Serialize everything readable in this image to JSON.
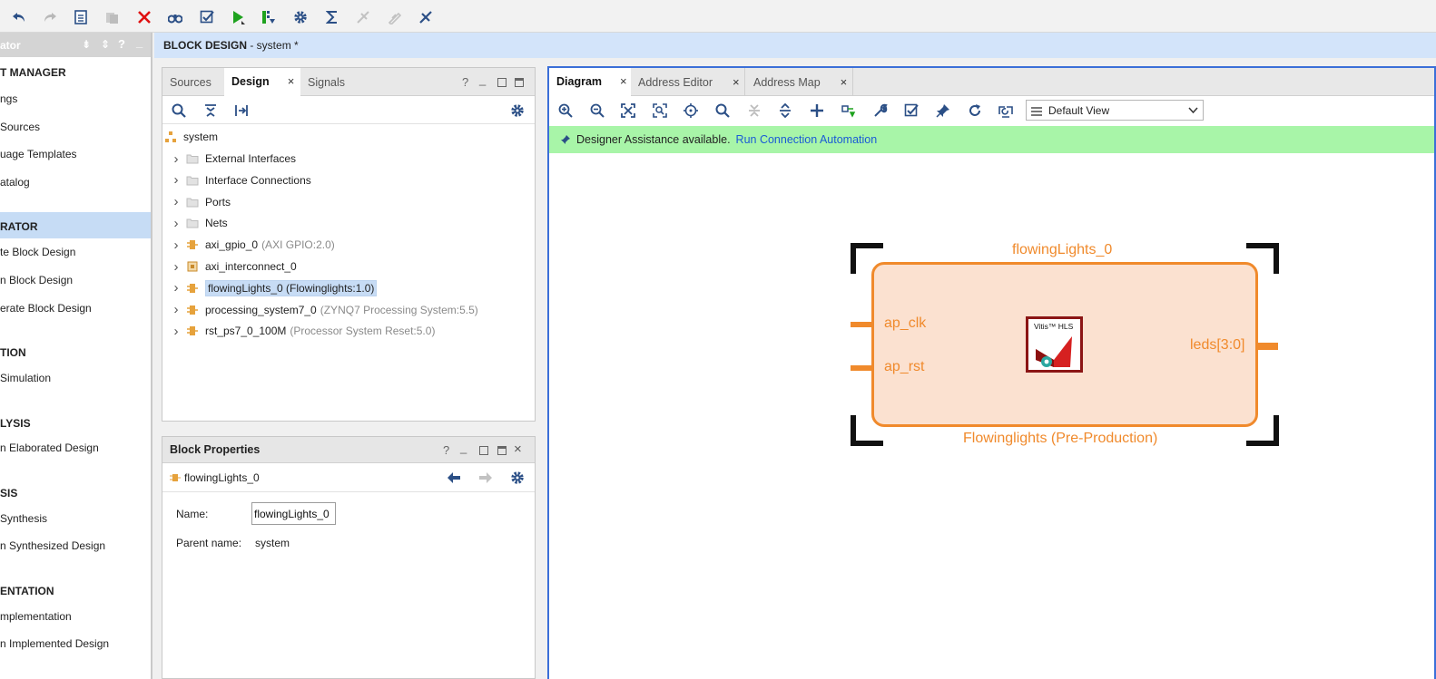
{
  "toolbar": {
    "icons": [
      "undo-icon",
      "redo-icon",
      "report-icon",
      "copy-icon",
      "delete-icon",
      "binoculars-icon",
      "validate-icon",
      "run-icon",
      "program-icon",
      "settings-icon",
      "sigma-icon",
      "debug-disabled-icon",
      "edit-disabled-icon",
      "tools-icon"
    ]
  },
  "flow_navigator": {
    "title": "ator",
    "sections": [
      {
        "label": "T MANAGER",
        "items": [
          "ngs",
          "Sources",
          "uage Templates",
          "atalog"
        ]
      },
      {
        "label": "RATOR",
        "items": [
          "te Block Design",
          "n Block Design",
          "erate Block Design"
        ]
      },
      {
        "label": "TION",
        "items": [
          "Simulation"
        ]
      },
      {
        "label": "LYSIS",
        "items": [
          "n Elaborated Design"
        ]
      },
      {
        "label": "SIS",
        "items": [
          "Synthesis",
          "n Synthesized Design"
        ]
      },
      {
        "label": "ENTATION",
        "items": [
          "mplementation",
          "n Implemented Design"
        ]
      }
    ]
  },
  "header": {
    "title": "BLOCK DESIGN",
    "subtitle": " - system *"
  },
  "sources_panel": {
    "tabs": [
      "Sources",
      "Design",
      "Signals"
    ],
    "active_tab": "Design",
    "tree": {
      "root": "system",
      "rows": [
        {
          "name": "External Interfaces",
          "detail": ""
        },
        {
          "name": "Interface Connections",
          "detail": ""
        },
        {
          "name": "Ports",
          "detail": ""
        },
        {
          "name": "Nets",
          "detail": ""
        },
        {
          "name": "axi_gpio_0",
          "detail": "(AXI GPIO:2.0)"
        },
        {
          "name": "axi_interconnect_0",
          "detail": ""
        },
        {
          "name": "flowingLights_0 (Flowinglights:1.0)",
          "detail": ""
        },
        {
          "name": "processing_system7_0",
          "detail": "(ZYNQ7 Processing System:5.5)"
        },
        {
          "name": "rst_ps7_0_100M",
          "detail": "(Processor System Reset:5.0)"
        }
      ]
    }
  },
  "block_properties": {
    "title": "Block Properties",
    "object": "flowingLights_0",
    "name_label": "Name:",
    "name_value": "flowingLights_0",
    "parent_label": "Parent name:",
    "parent_value": "system"
  },
  "diagram_panel": {
    "tabs": [
      "Diagram",
      "Address Editor",
      "Address Map"
    ],
    "active_tab": "Diagram",
    "view_select": "Default View",
    "assist_text": "Designer Assistance available.",
    "assist_link": "Run Connection Automation",
    "block": {
      "instance_name": "flowingLights_0",
      "type_label": "Flowinglights (Pre-Production)",
      "ports_in": [
        "ap_clk",
        "ap_rst"
      ],
      "ports_out": [
        "leds[3:0]"
      ],
      "logo_text": "Vitis™ HLS"
    },
    "colors": {
      "accent_orange": "#f08a2c",
      "block_fill": "#fbe1d0",
      "assist_green": "#a8f5a8",
      "panel_border": "#3b6fd8"
    }
  }
}
